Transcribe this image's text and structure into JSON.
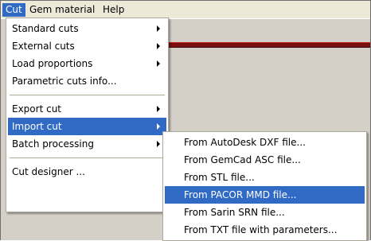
{
  "menubar": {
    "items": [
      {
        "label": "Cut",
        "active": true
      },
      {
        "label": "Gem material",
        "active": false
      },
      {
        "label": "Help",
        "active": false
      }
    ]
  },
  "cut_menu": {
    "items": [
      {
        "label": "Standard cuts",
        "submenu": true
      },
      {
        "label": "External cuts",
        "submenu": true
      },
      {
        "label": "Load proportions",
        "submenu": true
      },
      {
        "label": "Parametric cuts info...",
        "submenu": false
      },
      {
        "label": "Export cut",
        "submenu": true
      },
      {
        "label": "Import cut",
        "submenu": true,
        "highlighted": true
      },
      {
        "label": "Batch processing",
        "submenu": true
      },
      {
        "label": "Cut designer ...",
        "submenu": false
      }
    ]
  },
  "import_submenu": {
    "items": [
      {
        "label": "From AutoDesk DXF file..."
      },
      {
        "label": "From GemCad ASC file..."
      },
      {
        "label": "From STL file..."
      },
      {
        "label": "From PACOR MMD file...",
        "highlighted": true
      },
      {
        "label": "From Sarin SRN file..."
      },
      {
        "label": "From TXT file with parameters..."
      }
    ]
  },
  "colors": {
    "highlight": "#316ac5",
    "menubar": "#ece9d8",
    "workspace": "#d4d0c8",
    "accent_bar": "#7a1010"
  },
  "icons": [
    "submenu-arrow-icon"
  ]
}
